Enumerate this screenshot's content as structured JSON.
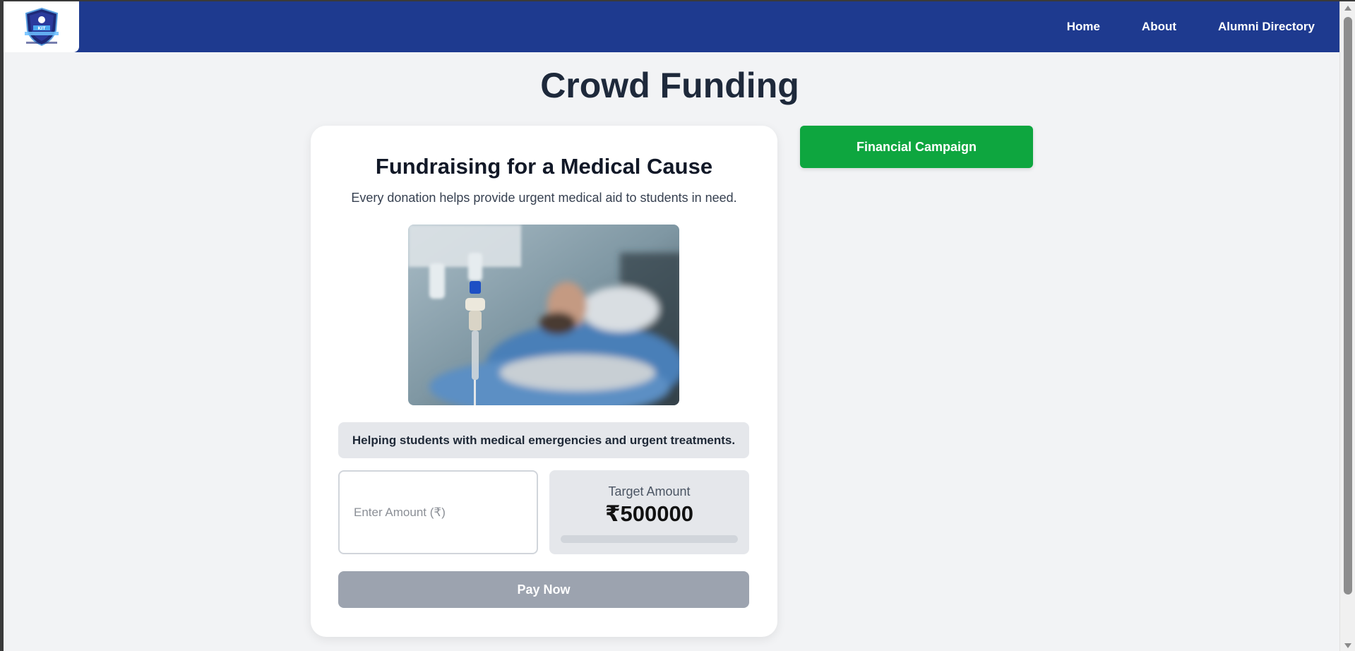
{
  "nav": {
    "logo_icon": "college-crest-logo",
    "links": [
      {
        "label": "Home"
      },
      {
        "label": "About"
      },
      {
        "label": "Alumni Directory"
      }
    ]
  },
  "page": {
    "title": "Crowd Funding"
  },
  "campaign_card": {
    "title": "Fundraising for a Medical Cause",
    "subtitle": "Every donation helps provide urgent medical aid to students in need.",
    "image_subject": "hospital-patient-iv-drip-photo",
    "description": "Helping students with medical emergencies and urgent treatments.",
    "amount_input": {
      "placeholder": "Enter Amount (₹)",
      "value": ""
    },
    "target": {
      "label": "Target Amount",
      "value": "₹500000",
      "progress_fraction": 0
    },
    "pay_button_label": "Pay Now"
  },
  "sidebar": {
    "campaign_button_label": "Financial Campaign"
  },
  "colors": {
    "navbar": "#1e3a8f",
    "campaign_button": "#0ea63f",
    "pay_button_disabled": "#9ca3af",
    "page_background": "#f2f3f5"
  }
}
